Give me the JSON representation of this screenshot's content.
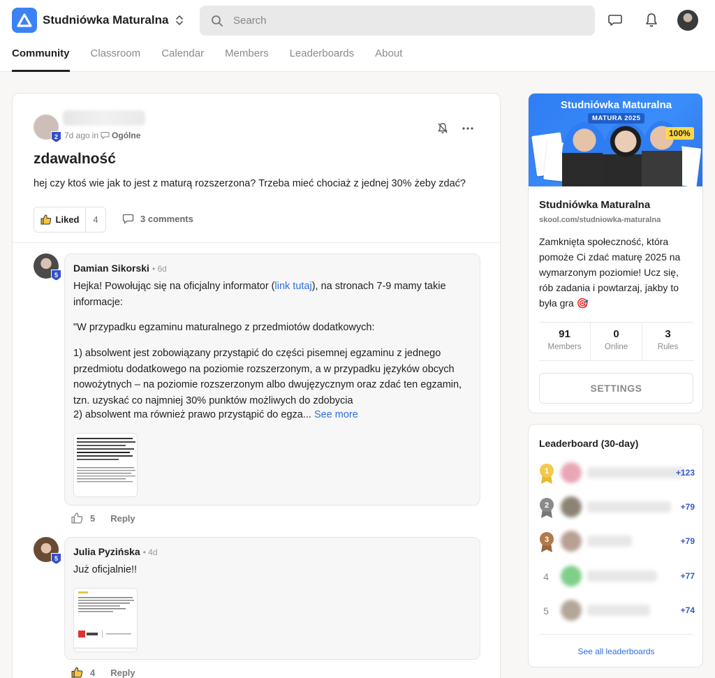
{
  "header": {
    "app_name": "Studniówka Maturalna",
    "search_placeholder": "Search",
    "accent": "#3b82f6"
  },
  "tabs": [
    {
      "label": "Community",
      "active": true
    },
    {
      "label": "Classroom"
    },
    {
      "label": "Calendar"
    },
    {
      "label": "Members"
    },
    {
      "label": "Leaderboards"
    },
    {
      "label": "About"
    }
  ],
  "post": {
    "author_level": "2",
    "time": "7d ago",
    "in_label": "in",
    "category": "Ogólne",
    "title": "zdawalność",
    "body": "hej czy ktoś wie jak to jest z maturą rozszerzona? Trzeba mieć chociaż z jednej 30% żeby zdać?",
    "like_label": "Liked",
    "like_count": "4",
    "comments_label": "3 comments"
  },
  "comments": [
    {
      "author": "Damian Sikorski",
      "level": "5",
      "time": "• 6d",
      "text_before_link": "Hejka! Powołując się na oficjalny informator (",
      "link_text": "link tutaj",
      "text_after_link": "), na stronach 7-9 mamy takie informacje:",
      "quote": "\"W przypadku egzaminu maturalnego z przedmiotów dodatkowych:",
      "point1": "1) absolwent jest zobowiązany przystąpić do części pisemnej egzaminu z jednego przedmiotu dodatkowego na poziomie rozszerzonym, a w przypadku języków obcych nowożytnych – na poziomie rozszerzonym albo dwujęzycznym oraz zdać ten egzamin, tzn. uzyskać co najmniej 30% punktów możliwych do zdobycia",
      "point2": "2) absolwent ma również prawo przystąpić do egza...",
      "see_more": "See more",
      "likes": "5",
      "reply": "Reply"
    },
    {
      "author": "Julia Pyzińska",
      "level": "5",
      "time": "• 4d",
      "text": "Już oficjalnie!!",
      "likes": "4",
      "reply": "Reply"
    }
  ],
  "group": {
    "cover_title": "Studniówka Maturalna",
    "cover_sub": "MATURA 2025",
    "cover_pct": "100%",
    "name": "Studniówka Maturalna",
    "url": "skool.com/studniowka-maturalna",
    "description": "Zamknięta społeczność, która pomoże Ci zdać maturę 2025 na wymarzonym poziomie! Ucz się, rób zadania i powtarzaj, jakby to była gra 🎯",
    "stats": [
      {
        "num": "91",
        "label": "Members"
      },
      {
        "num": "0",
        "label": "Online"
      },
      {
        "num": "3",
        "label": "Rules"
      }
    ],
    "settings_label": "SETTINGS"
  },
  "leaderboard": {
    "title": "Leaderboard (30-day)",
    "rows": [
      {
        "rank": "1",
        "points": "+123",
        "medal_color": "#f2c94c"
      },
      {
        "rank": "2",
        "points": "+79",
        "medal_color": "#8a8a8a"
      },
      {
        "rank": "3",
        "points": "+79",
        "medal_color": "#b07a4a"
      },
      {
        "rank": "4",
        "points": "+77"
      },
      {
        "rank": "5",
        "points": "+74"
      }
    ],
    "see_all": "See all leaderboards"
  }
}
